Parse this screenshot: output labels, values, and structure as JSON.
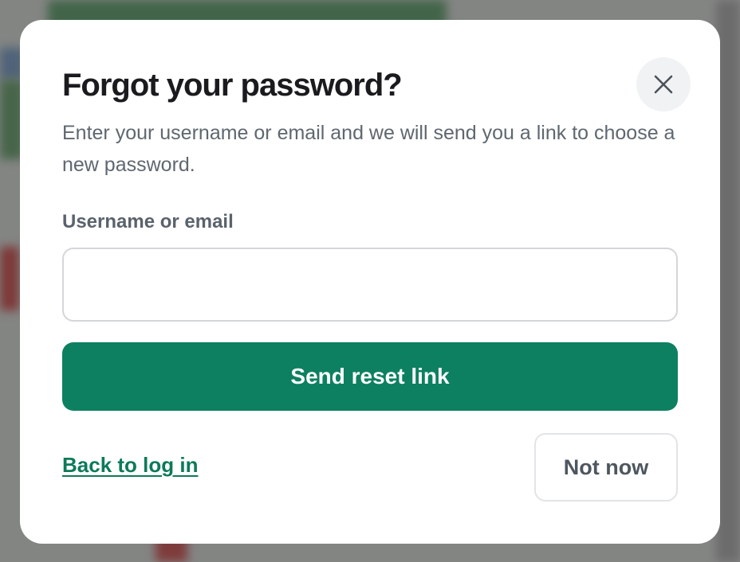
{
  "modal": {
    "title": "Forgot your password?",
    "description": "Enter your username or email and we will send you a link to choose a new password.",
    "close_icon": "close-icon",
    "field": {
      "label": "Username or email",
      "value": "",
      "placeholder": ""
    },
    "send_button_label": "Send reset link",
    "back_link_label": "Back to log in",
    "not_now_label": "Not now"
  },
  "colors": {
    "primary": "#0c8060",
    "link": "#0c7a5a",
    "title": "#1b1b1f",
    "muted_text": "#5f6770",
    "close_bg": "#f1f2f4"
  }
}
